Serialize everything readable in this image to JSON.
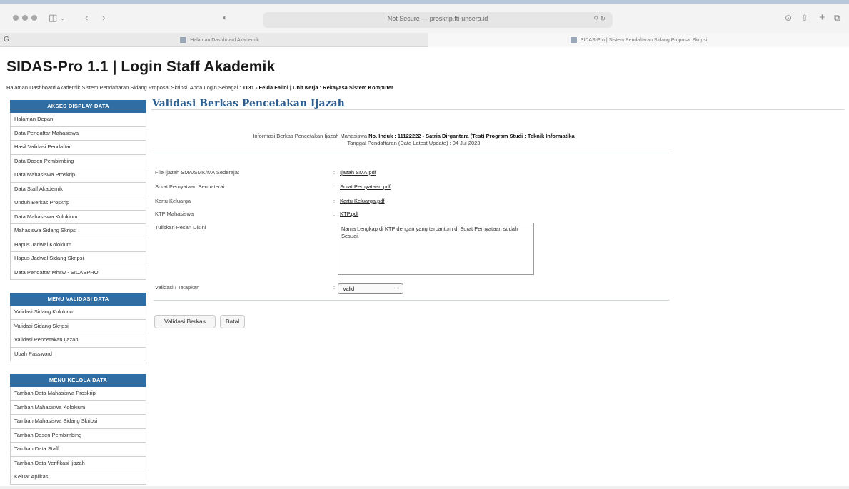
{
  "browser": {
    "url_text": "Not Secure — proskrip.fti-unsera.id",
    "url_right": "⚲ ↻",
    "tab_left_letter": "G",
    "tabs": [
      {
        "label": "Halaman Dashboard Akademik"
      },
      {
        "label": "SIDAS-Pro | Sistem Pendaftaran Sidang Proposal Skripsi"
      }
    ]
  },
  "header": {
    "title": "SIDAS-Pro 1.1 | Login Staff Akademik",
    "info_prefix": "Halaman Dashboard Akademik Sistem Pendaftaran Sidang Proposal Skripsi. Anda Login Sebagai : ",
    "info_bold": "1131 - Felda Falini | Unit Kerja : Rekayasa Sistem Komputer"
  },
  "sidebar": {
    "sections": [
      {
        "heading": "AKSES DISPLAY DATA",
        "items": [
          "Halaman Depan",
          "Data Pendaftar Mahasiswa",
          "Hasil Validasi Pendaftar",
          "Data Dosen Pembimbing",
          "Data Mahasiswa Proskrip",
          "Data Staff Akademik",
          "Unduh Berkas Proskrip",
          "Data Mahasiswa Kolokium",
          "Mahasiswa Sidang Skripsi",
          "Hapus Jadwal Kolokium",
          "Hapus Jadwal Sidang Skripsi",
          "Data Pendaftar Mhsw - SIDASPRO"
        ]
      },
      {
        "heading": "MENU VALIDASI DATA",
        "items": [
          "Validasi Sidang Kolokium",
          "Validasi Sidang Skripsi",
          "Validasi Pencetakan Ijazah",
          "Ubah Password"
        ]
      },
      {
        "heading": "MENU KELOLA DATA",
        "items": [
          "Tambah Data Mahasiswa Proskrip",
          "Tambah Mahasiswa Kolokium",
          "Tambah Mahasiswa Sidang Skripsi",
          "Tambah Dosen Pembimbing",
          "Tambah Data Staff",
          "Tambah Data Verifikasi Ijazah",
          "Keluar Aplikasi"
        ]
      }
    ]
  },
  "main": {
    "title": "Validasi Berkas Pencetakan Ijazah",
    "info_prefix": "Informasi Berkas Pencetakan Ijazah Mahasiswa ",
    "info_bold": "No. Induk : 11122222 - Satria Dirgantara (Test) Program Studi : Teknik Informatika",
    "info_date": "Tanggal Pendaftaran (Date Latest Update) : 04 Jul 2023",
    "separator": ":",
    "files": [
      {
        "label": "File Ijazah SMA/SMK/MA Sederajat",
        "file": "Ijazah SMA.pdf"
      },
      {
        "label": "Surat Pernyataan Bermaterai",
        "file": "Surat Pernyataan.pdf"
      },
      {
        "label": "Kartu Keluarga",
        "file": "Kartu Keluarga.pdf"
      },
      {
        "label": "KTP Mahasiswa",
        "file": "KTP.pdf"
      }
    ],
    "message_label": "Tuliskan Pesan Disini",
    "message_value": "Nama Lengkap di KTP dengan yang tercantum di Surat Pernyataan sudah Sesuai.",
    "validasi_label": "Validasi / Tetapkan",
    "validasi_value": "Valid",
    "submit_label": "Validasi Berkas",
    "cancel_label": "Batal"
  }
}
